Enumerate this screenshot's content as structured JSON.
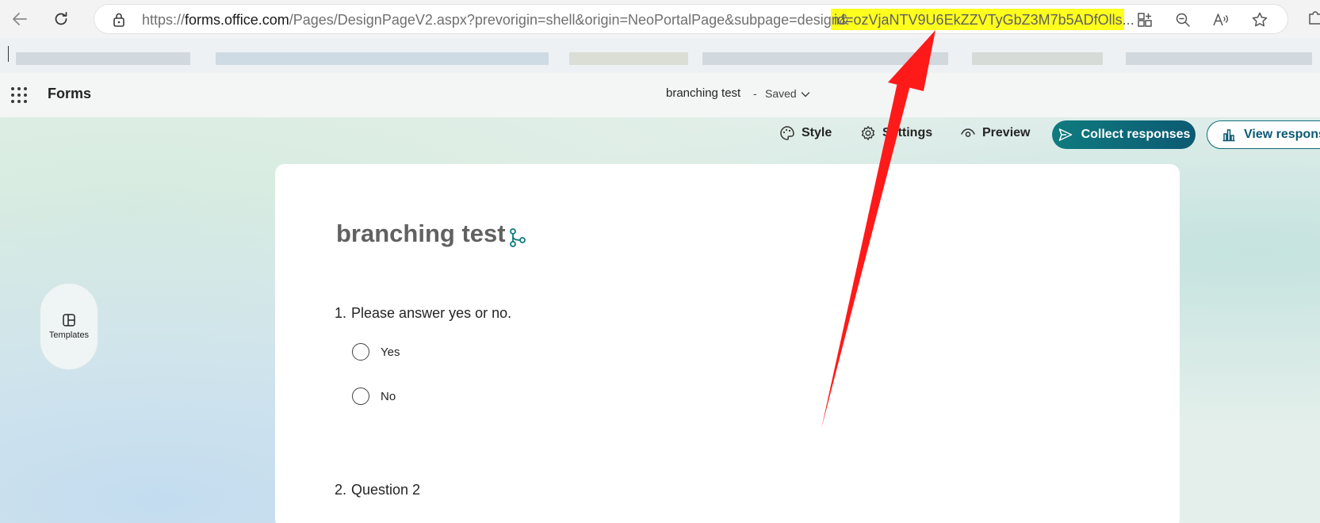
{
  "browser": {
    "url_prefix": "https://",
    "url_domain": "forms.office.com",
    "url_path": "/Pages/DesignPageV2.aspx?prevorigin=shell&origin=NeoPortalPage&subpage=design&",
    "url_highlight": "id=ozVjaNTV9U6EkZZVTyGbZ3M7b5ADfOlls...",
    "highlight_color": "#ffff1e"
  },
  "header": {
    "app_name": "Forms",
    "form_name": "branching test",
    "separator": "-",
    "save_status": "Saved"
  },
  "toolbar": {
    "style_label": "Style",
    "settings_label": "Settings",
    "preview_label": "Preview",
    "collect_label": "Collect responses",
    "view_label": "View responses"
  },
  "sidebar": {
    "templates_label": "Templates"
  },
  "form": {
    "title": "branching test",
    "questions": [
      {
        "number": "1.",
        "text": "Please answer yes or no.",
        "options": [
          "Yes",
          "No"
        ]
      },
      {
        "number": "2.",
        "text": "Question 2"
      }
    ]
  },
  "colors": {
    "accent": "#0f7b7f",
    "annotation_arrow": "#ff1a1a"
  }
}
